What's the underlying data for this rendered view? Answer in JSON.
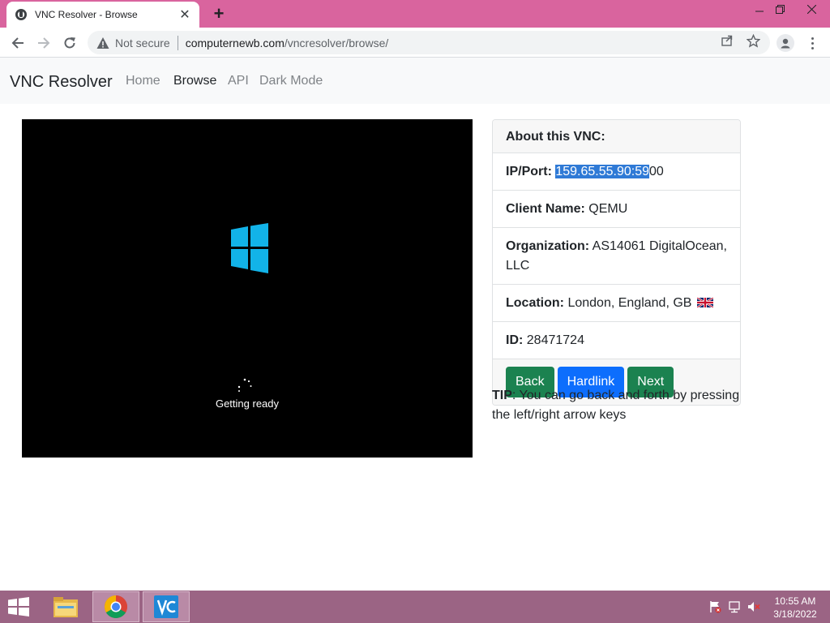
{
  "browser": {
    "tab_title": "VNC Resolver - Browse",
    "security_label": "Not secure",
    "url_host": "computernewb.com",
    "url_path": "/vncresolver/browse/"
  },
  "site": {
    "brand": "VNC Resolver",
    "nav": [
      "Home",
      "Browse",
      "API",
      "Dark Mode"
    ],
    "active_nav": "Browse"
  },
  "vnc_screen": {
    "status_text": "Getting ready",
    "logo_color": "#12b3e8"
  },
  "card": {
    "header": "About this VNC:",
    "ip_label": "IP/Port:",
    "ip_value_selected": "159.65.55.90:59",
    "ip_value_rest": "00",
    "client_label": "Client Name:",
    "client_value": "QEMU",
    "org_label": "Organization:",
    "org_value": "AS14061 DigitalOcean, LLC",
    "location_label": "Location:",
    "location_value": "London, England, GB",
    "id_label": "ID:",
    "id_value": "28471724",
    "buttons": {
      "back": "Back",
      "hardlink": "Hardlink",
      "next": "Next"
    }
  },
  "tip": {
    "label": "TIP",
    "text": ": You can go back and forth by pressing the left/right arrow keys"
  },
  "taskbar": {
    "time": "10:55 AM",
    "date": "3/18/2022"
  },
  "colors": {
    "tabstrip": "#d9649e",
    "taskbar": "#9b6484",
    "green_button": "#1b8250",
    "blue_button": "#0d6efd",
    "selection": "#2f7ad6"
  }
}
